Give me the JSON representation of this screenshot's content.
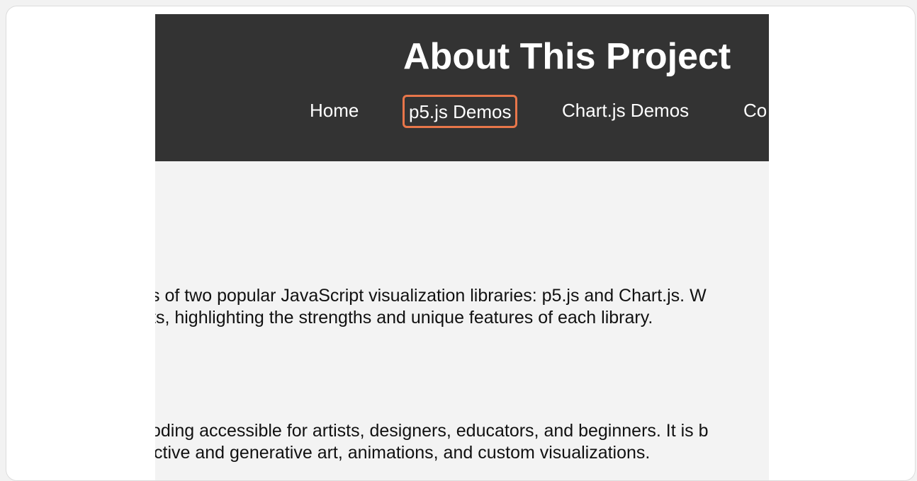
{
  "header": {
    "title": "About This Project",
    "nav": {
      "home": "Home",
      "p5_demos": "p5.js Demos",
      "chartjs_demos": "Chart.js Demos",
      "truncated": "Co"
    }
  },
  "content": {
    "paragraph_1": [
      "s of two popular JavaScript visualization libraries: p5.js and Chart.js. W",
      "ts, highlighting the strengths and unique features of each library."
    ],
    "paragraph_2": [
      "oding accessible for artists, designers, educators, and beginners. It is b",
      "ctive and generative art, animations, and custom visualizations."
    ]
  },
  "colors": {
    "header_bg": "#333333",
    "page_bg": "#f3f3f3",
    "highlight": "#e8764a"
  }
}
